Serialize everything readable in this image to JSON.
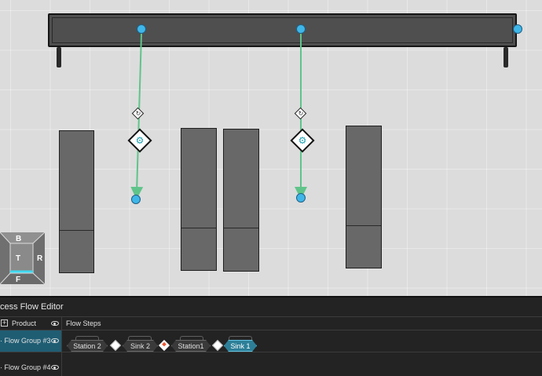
{
  "viewport": {
    "navcube": {
      "top": "B",
      "left": "",
      "center": "T",
      "right": "R",
      "bottom": "F"
    },
    "flow_arrow_color": "#5fc48a",
    "node_color": "#3fb6e8",
    "icons": {
      "process": "robot-arm-icon",
      "transfer": "flow-step-icon"
    }
  },
  "editor": {
    "title": "cess Flow Editor",
    "header": {
      "product_label": "Product",
      "steps_label": "Flow Steps"
    },
    "groups": [
      {
        "label": "Flow Group #3",
        "selected": true
      },
      {
        "label": "Flow Group #4",
        "selected": false
      }
    ],
    "steps": [
      {
        "label": "Station 2",
        "selected": false
      },
      {
        "label": "Sink 2",
        "selected": false
      },
      {
        "label": "Station1",
        "selected": false
      },
      {
        "label": "Sink 1",
        "selected": true
      }
    ],
    "accent": "#2d7f98"
  }
}
